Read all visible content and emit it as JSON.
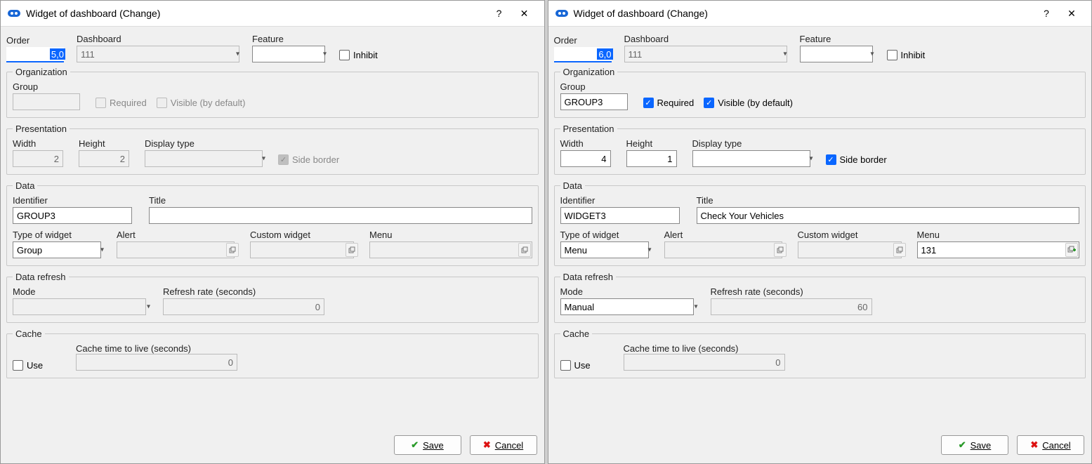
{
  "windows": [
    {
      "title": "Widget of dashboard (Change)",
      "top": {
        "order_label": "Order",
        "order_value": "5,0",
        "dashboard_label": "Dashboard",
        "dashboard_value": "111",
        "feature_label": "Feature",
        "feature_value": "",
        "inhibit_label": "Inhibit",
        "inhibit_checked": false
      },
      "organization": {
        "legend": "Organization",
        "group_label": "Group",
        "group_value": "",
        "group_disabled": true,
        "required_label": "Required",
        "required_checked": false,
        "required_disabled": true,
        "visible_label": "Visible (by default)",
        "visible_checked": false,
        "visible_disabled": true
      },
      "presentation": {
        "legend": "Presentation",
        "width_label": "Width",
        "width_value": "2",
        "width_disabled": true,
        "height_label": "Height",
        "height_value": "2",
        "height_disabled": true,
        "display_label": "Display type",
        "display_value": "",
        "display_disabled": true,
        "sideborder_label": "Side border",
        "sideborder_checked": true,
        "sideborder_disabled": true
      },
      "data": {
        "legend": "Data",
        "identifier_label": "Identifier",
        "identifier_value": "GROUP3",
        "title_label": "Title",
        "title_value": "",
        "type_label": "Type of widget",
        "type_value": "Group",
        "alert_label": "Alert",
        "alert_value": "",
        "custom_label": "Custom widget",
        "custom_value": "",
        "menu_label": "Menu",
        "menu_value": "",
        "menu_green": false
      },
      "refresh": {
        "legend": "Data refresh",
        "mode_label": "Mode",
        "mode_value": "",
        "rate_label": "Refresh rate (seconds)",
        "rate_value": "0"
      },
      "cache": {
        "legend": "Cache",
        "use_label": "Use",
        "use_checked": false,
        "ttl_label": "Cache time to live (seconds)",
        "ttl_value": "0"
      },
      "buttons": {
        "save": "Save",
        "cancel": "Cancel"
      }
    },
    {
      "title": "Widget of dashboard (Change)",
      "top": {
        "order_label": "Order",
        "order_value": "6,0",
        "dashboard_label": "Dashboard",
        "dashboard_value": "111",
        "feature_label": "Feature",
        "feature_value": "",
        "inhibit_label": "Inhibit",
        "inhibit_checked": false
      },
      "organization": {
        "legend": "Organization",
        "group_label": "Group",
        "group_value": "GROUP3",
        "group_disabled": false,
        "required_label": "Required",
        "required_checked": true,
        "required_disabled": false,
        "visible_label": "Visible (by default)",
        "visible_checked": true,
        "visible_disabled": false
      },
      "presentation": {
        "legend": "Presentation",
        "width_label": "Width",
        "width_value": "4",
        "width_disabled": false,
        "height_label": "Height",
        "height_value": "1",
        "height_disabled": false,
        "display_label": "Display type",
        "display_value": "",
        "display_disabled": false,
        "sideborder_label": "Side border",
        "sideborder_checked": true,
        "sideborder_disabled": false
      },
      "data": {
        "legend": "Data",
        "identifier_label": "Identifier",
        "identifier_value": "WIDGET3",
        "title_label": "Title",
        "title_value": "Check Your Vehicles",
        "type_label": "Type of widget",
        "type_value": "Menu",
        "alert_label": "Alert",
        "alert_value": "",
        "custom_label": "Custom widget",
        "custom_value": "",
        "menu_label": "Menu",
        "menu_value": "131",
        "menu_green": true
      },
      "refresh": {
        "legend": "Data refresh",
        "mode_label": "Mode",
        "mode_value": "Manual",
        "rate_label": "Refresh rate (seconds)",
        "rate_value": "60"
      },
      "cache": {
        "legend": "Cache",
        "use_label": "Use",
        "use_checked": false,
        "ttl_label": "Cache time to live (seconds)",
        "ttl_value": "0"
      },
      "buttons": {
        "save": "Save",
        "cancel": "Cancel"
      }
    }
  ]
}
